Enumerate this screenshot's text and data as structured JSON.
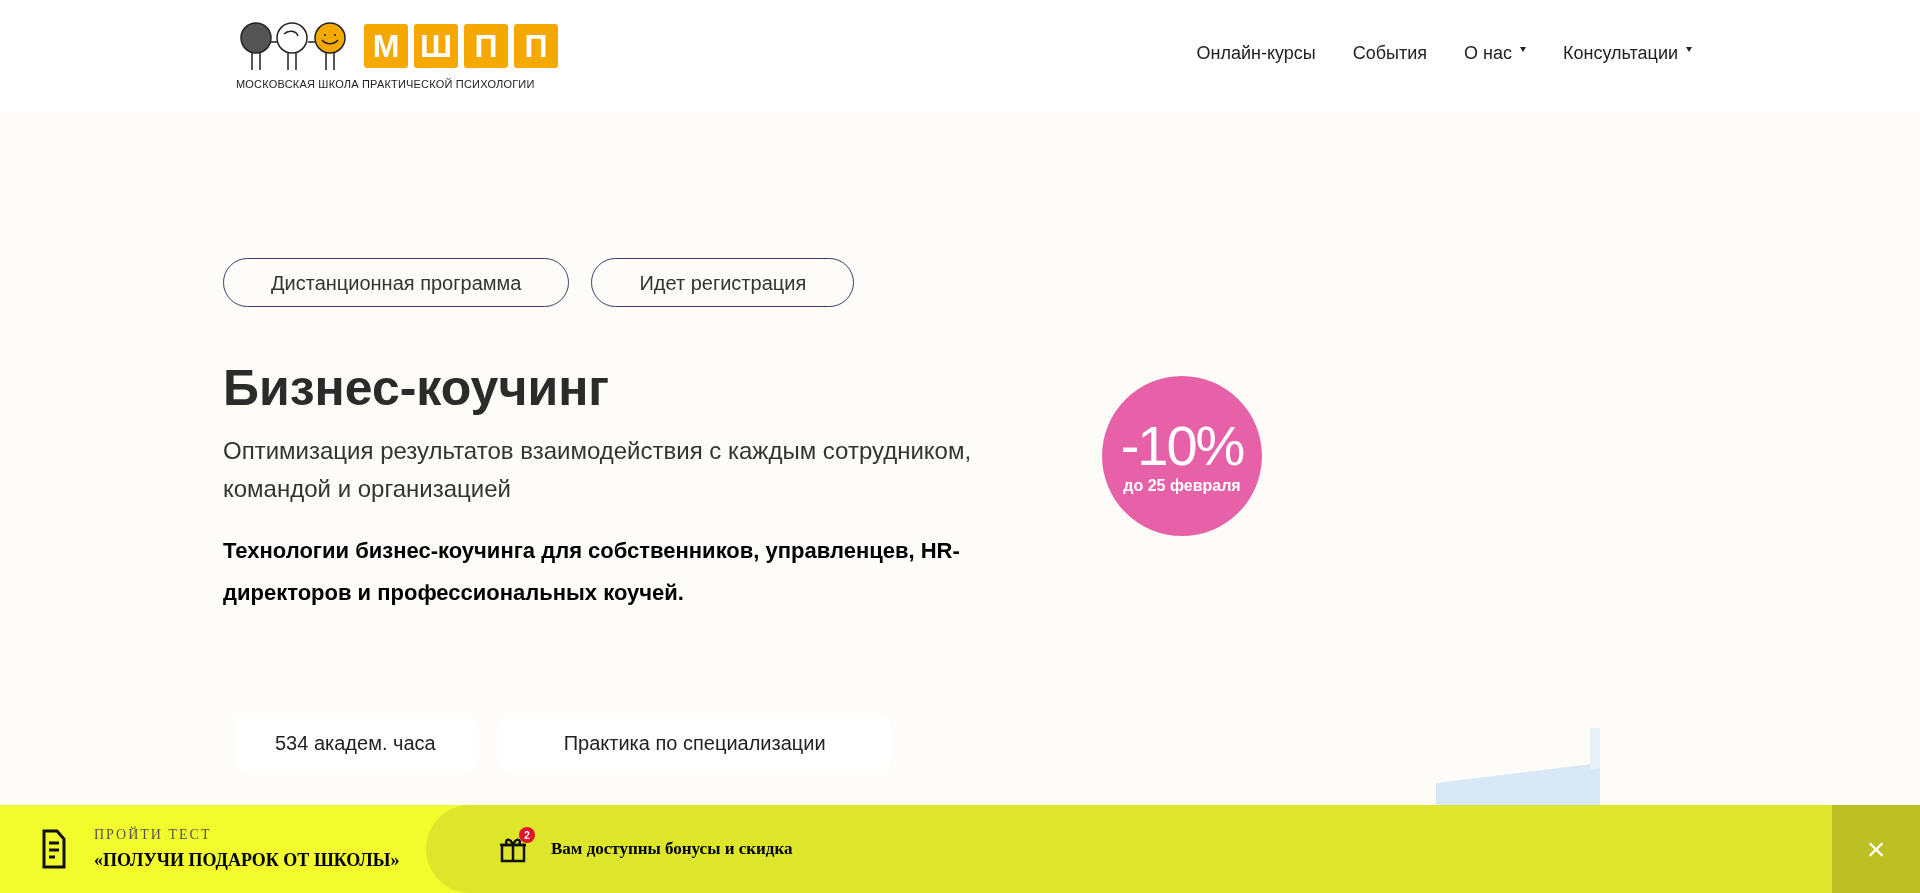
{
  "header": {
    "logo": {
      "letters": [
        "М",
        "Ш",
        "П",
        "П"
      ],
      "tagline": "МОСКОВСКАЯ ШКОЛА ПРАКТИЧЕСКОЙ ПСИХОЛОГИИ"
    },
    "nav": [
      {
        "label": "Онлайн-курсы",
        "dropdown": false
      },
      {
        "label": "События",
        "dropdown": false
      },
      {
        "label": "О нас",
        "dropdown": true
      },
      {
        "label": "Консультации",
        "dropdown": true
      }
    ]
  },
  "hero": {
    "tags": [
      "Дистанционная программа",
      "Идет регистрация"
    ],
    "title": "Бизнес-коучинг",
    "subtitle": "Оптимизация результатов взаимодействия с каждым сотрудником, командой и организацией",
    "description": "Технологии бизнес-коучинга для собственников, управленцев, HR-директоров и профессиональных коучей.",
    "discount": {
      "value": "-10%",
      "until": "до 25 февраля"
    },
    "features": [
      "534 академ. часа",
      "Практика по специализации"
    ]
  },
  "promo_bar": {
    "test_label": "ПРОЙТИ ТЕСТ",
    "test_title": "«ПОЛУЧИ ПОДАРОК ОТ ШКОЛЫ»",
    "gift_count": "2",
    "bonus_text": "Вам доступны бонусы и скидка",
    "close": "×"
  }
}
